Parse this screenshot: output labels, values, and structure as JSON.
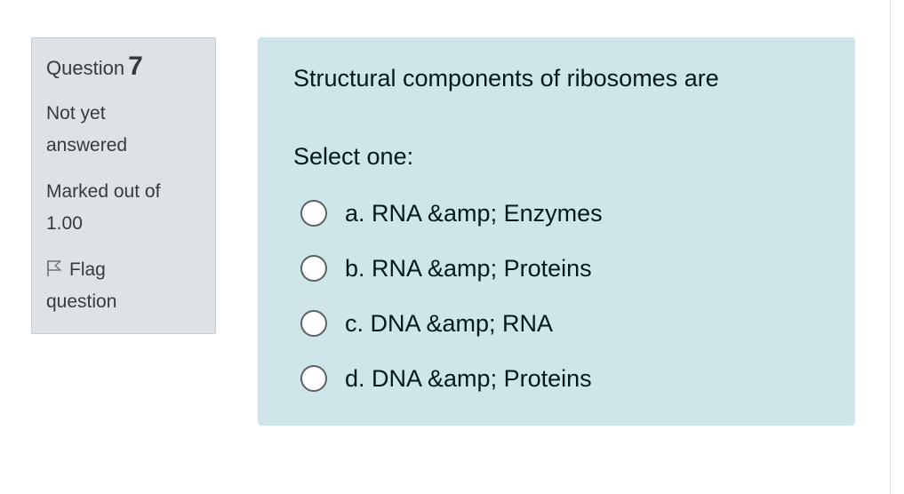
{
  "question_info": {
    "label": "Question",
    "number": "7",
    "state_line1": "Not yet",
    "state_line2": "answered",
    "grade_line1": "Marked out of",
    "grade_line2": "1.00",
    "flag_line1": "Flag",
    "flag_line2": "question"
  },
  "question": {
    "text": "Structural components of ribosomes are",
    "prompt": "Select one:",
    "options": [
      {
        "label": "a. RNA &amp; Enzymes",
        "selected": false
      },
      {
        "label": "b. RNA &amp; Proteins",
        "selected": false
      },
      {
        "label": "c. DNA &amp; RNA",
        "selected": false
      },
      {
        "label": "d. DNA &amp; Proteins",
        "selected": false
      }
    ]
  },
  "colors": {
    "info_background": "#dee2e6",
    "content_background": "#cee6ea",
    "text": "#001a1e"
  },
  "icons": {
    "flag": "flag-icon",
    "radio": "radio-icon"
  }
}
